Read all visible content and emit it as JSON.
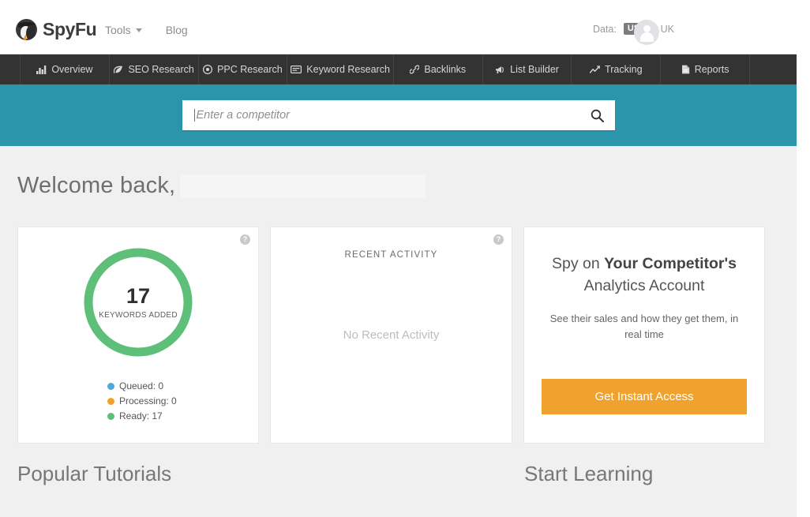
{
  "brand": {
    "name": "SpyFu",
    "logo_icon": "spy-logo-icon"
  },
  "topnav": {
    "items": [
      {
        "label": "Tools",
        "has_caret": true
      },
      {
        "label": "Blog",
        "has_caret": false
      }
    ]
  },
  "topright": {
    "data_label": "Data:",
    "locale_active": "US",
    "separator": "/",
    "locale_other": "UK",
    "avatar_icon": "user-avatar-icon"
  },
  "mainnav": {
    "items": [
      {
        "label": "Overview",
        "icon": "bar-chart-icon"
      },
      {
        "label": "SEO Research",
        "icon": "leaf-icon"
      },
      {
        "label": "PPC Research",
        "icon": "target-icon"
      },
      {
        "label": "Keyword Research",
        "icon": "card-icon"
      },
      {
        "label": "Backlinks",
        "icon": "link-icon"
      },
      {
        "label": "List Builder",
        "icon": "bullhorn-icon"
      },
      {
        "label": "Tracking",
        "icon": "line-chart-icon"
      },
      {
        "label": "Reports",
        "icon": "document-icon"
      }
    ]
  },
  "search": {
    "placeholder": "Enter a competitor",
    "value": "",
    "button_icon": "search-icon"
  },
  "welcome": {
    "greeting": "Welcome back,"
  },
  "cards": {
    "keywords": {
      "help_icon": "help-circle-icon",
      "help_glyph": "?",
      "value": "17",
      "label": "KEYWORDS ADDED",
      "ring_color": "#5dbf78",
      "legend": [
        {
          "label": "Queued: 0",
          "color": "#4fa8dc"
        },
        {
          "label": "Processing: 0",
          "color": "#f0a22e"
        },
        {
          "label": "Ready: 17",
          "color": "#5dbf78"
        }
      ]
    },
    "activity": {
      "help_icon": "help-circle-icon",
      "help_glyph": "?",
      "title": "RECENT ACTIVITY",
      "empty_text": "No Recent Activity"
    },
    "promo": {
      "headline_pre": "Spy on ",
      "headline_bold": "Your Competitor's",
      "headline_post": " Analytics Account",
      "subtext": "See their sales and how they get them, in real time",
      "button_label": "Get Instant Access",
      "button_color": "#f0a22e"
    }
  },
  "bottom": {
    "tutorials_heading": "Popular Tutorials",
    "learning_heading": "Start Learning"
  },
  "theme": {
    "teal": "#2b95ab",
    "nav_dark": "#333333",
    "page_bg": "#f0f0f0",
    "orange": "#f0a22e",
    "green": "#5dbf78"
  }
}
